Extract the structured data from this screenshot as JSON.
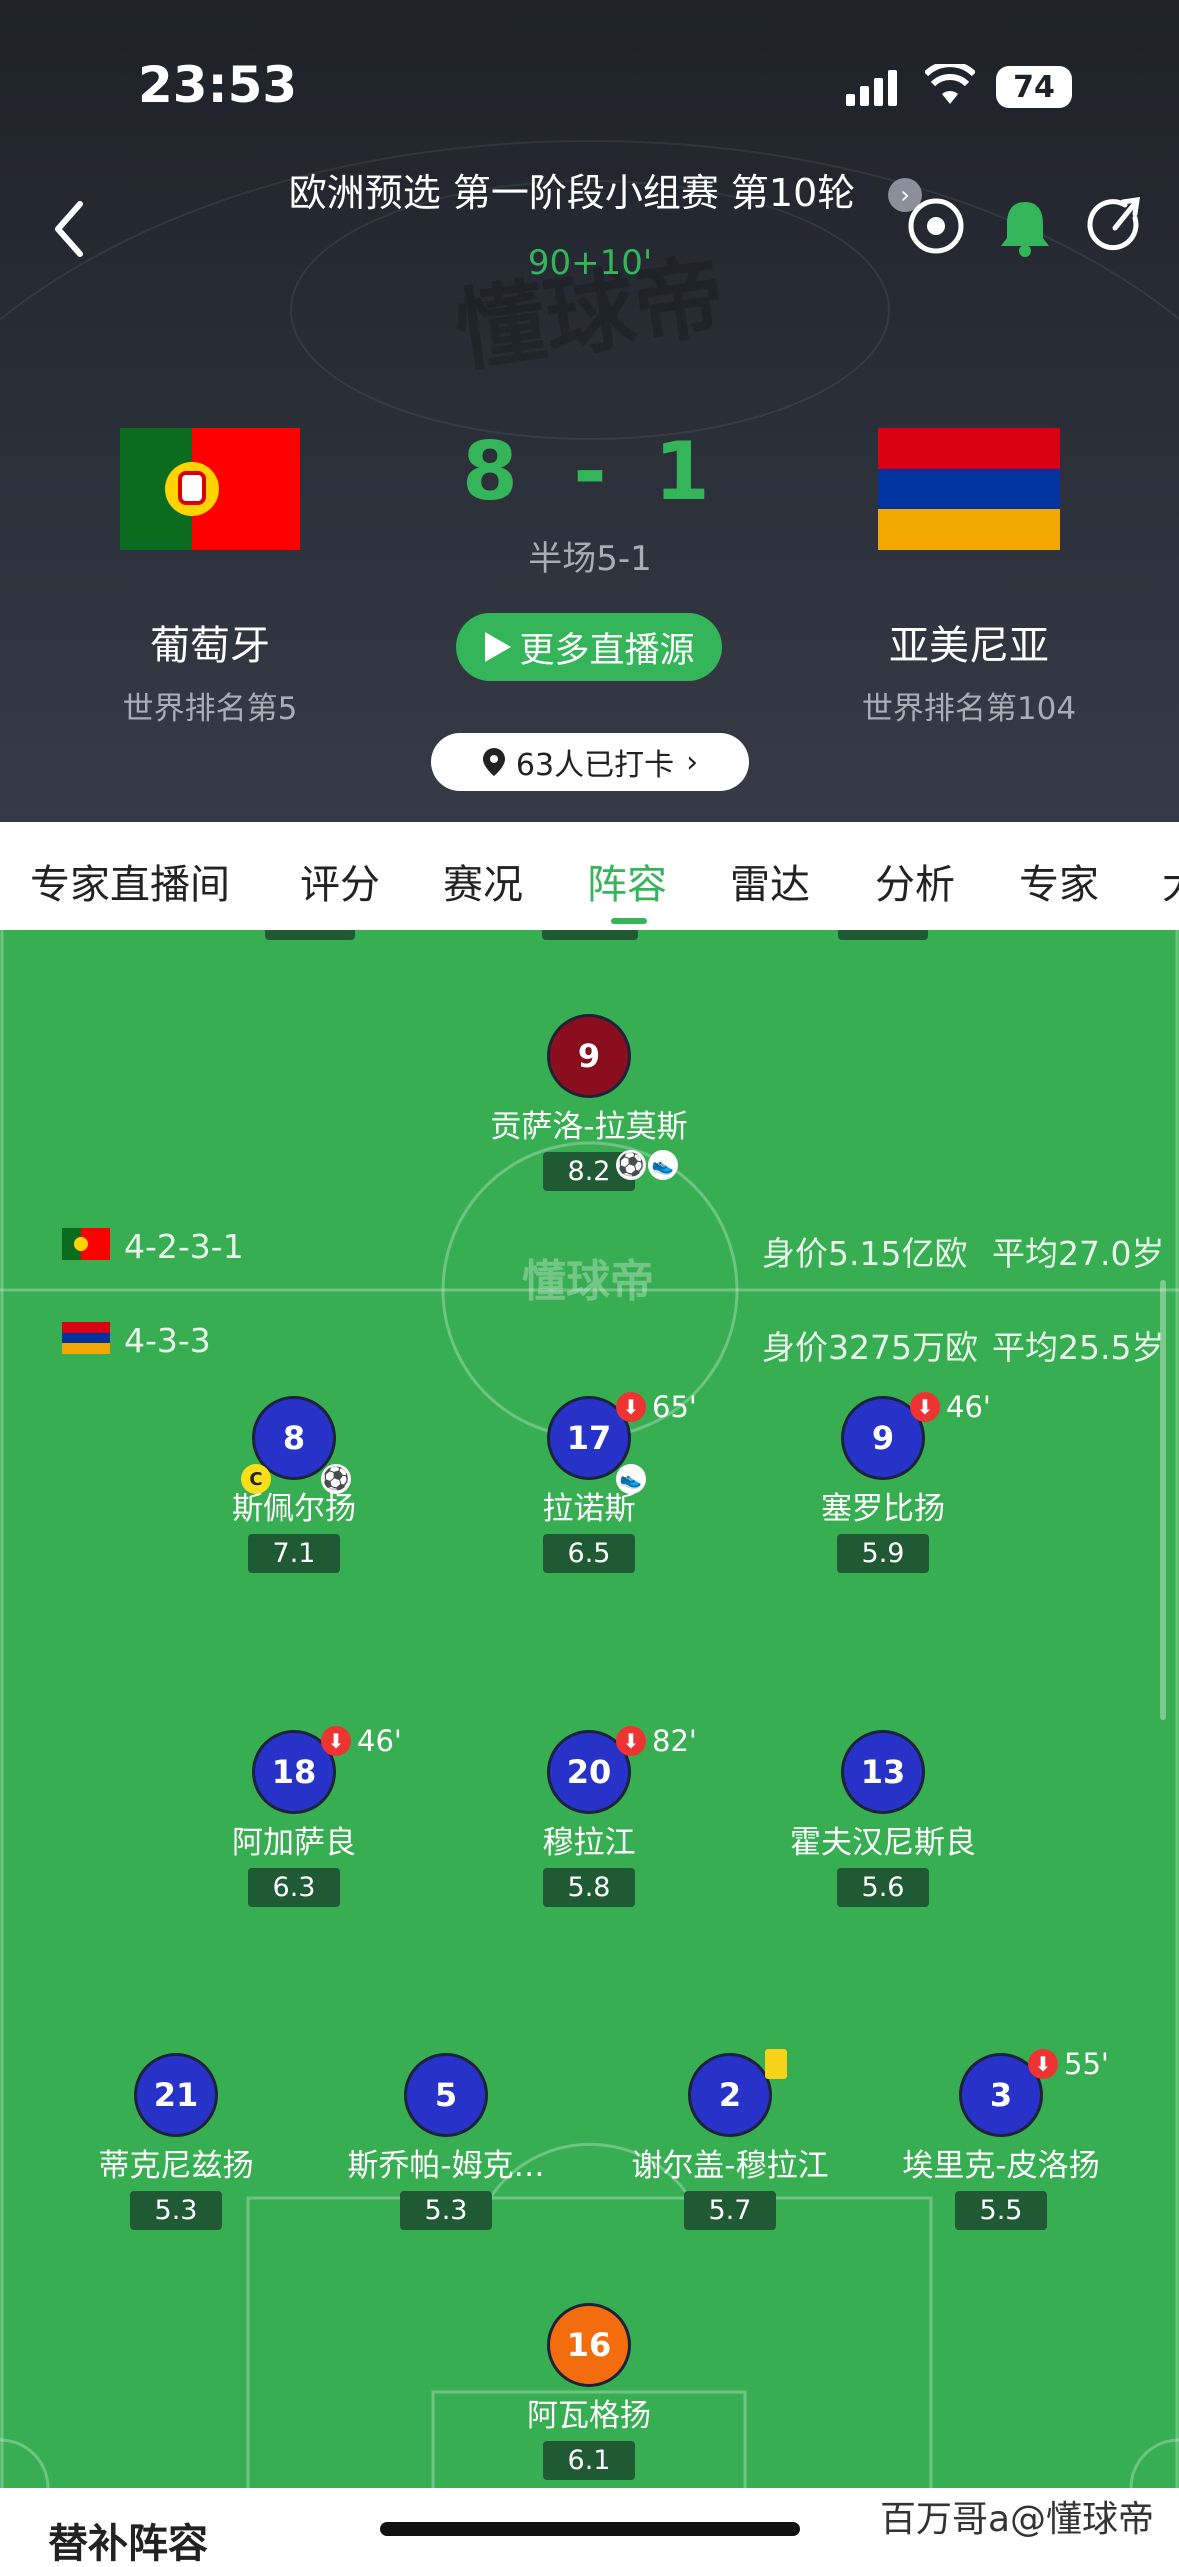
{
  "status_bar": {
    "time": "23:53",
    "battery": "74"
  },
  "header": {
    "competition": "欧洲预选 第一阶段小组赛 第10轮",
    "match_time": "90+10'",
    "home": {
      "name": "葡萄牙",
      "rank": "世界排名第5",
      "score": "8"
    },
    "away": {
      "name": "亚美尼亚",
      "rank": "世界排名第104",
      "score": "1"
    },
    "score_sep": "-",
    "halftime": "半场5-1",
    "stream_button": "更多直播源",
    "checkin": "63人已打卡",
    "watermark": "懂球帝"
  },
  "tabs": [
    "专家直播间",
    "评分",
    "赛况",
    "阵容",
    "雷达",
    "分析",
    "专家",
    "大"
  ],
  "active_tab": "阵容",
  "lineup": {
    "home": {
      "formation": "4-2-3-1",
      "value": "身价5.15亿欧",
      "avg_age": "平均27.0岁"
    },
    "away": {
      "formation": "4-3-3",
      "value": "身价3275万欧",
      "avg_age": "平均25.5岁"
    },
    "center_logo": "懂球帝",
    "home_player": {
      "number": "9",
      "name": "贡萨洛-拉莫斯",
      "rating": "8.2"
    },
    "away_players": [
      {
        "number": "8",
        "name": "斯佩尔扬",
        "rating": "7.1",
        "captain": "C"
      },
      {
        "number": "17",
        "name": "拉诺斯",
        "rating": "6.5",
        "sub_minute": "65'"
      },
      {
        "number": "9",
        "name": "塞罗比扬",
        "rating": "5.9",
        "sub_minute": "46'"
      },
      {
        "number": "18",
        "name": "阿加萨良",
        "rating": "6.3",
        "sub_minute": "46'"
      },
      {
        "number": "20",
        "name": "穆拉江",
        "rating": "5.8",
        "sub_minute": "82'"
      },
      {
        "number": "13",
        "name": "霍夫汉尼斯良",
        "rating": "5.6"
      },
      {
        "number": "21",
        "name": "蒂克尼兹扬",
        "rating": "5.3"
      },
      {
        "number": "5",
        "name": "斯乔帕-姆克…",
        "rating": "5.3"
      },
      {
        "number": "2",
        "name": "谢尔盖-穆拉江",
        "rating": "5.7"
      },
      {
        "number": "3",
        "name": "埃里克-皮洛扬",
        "rating": "5.5",
        "sub_minute": "55'"
      },
      {
        "number": "16",
        "name": "阿瓦格扬",
        "rating": "6.1"
      }
    ]
  },
  "bottom": {
    "subs_title": "替补阵容",
    "watermark": "百万哥a@懂球帝"
  },
  "colors": {
    "accent": "#34b55a",
    "pitch": "#37ae52",
    "home_kit": "#8b0e1f",
    "away_kit": "#2732c9",
    "gk_kit": "#f36c0d"
  }
}
